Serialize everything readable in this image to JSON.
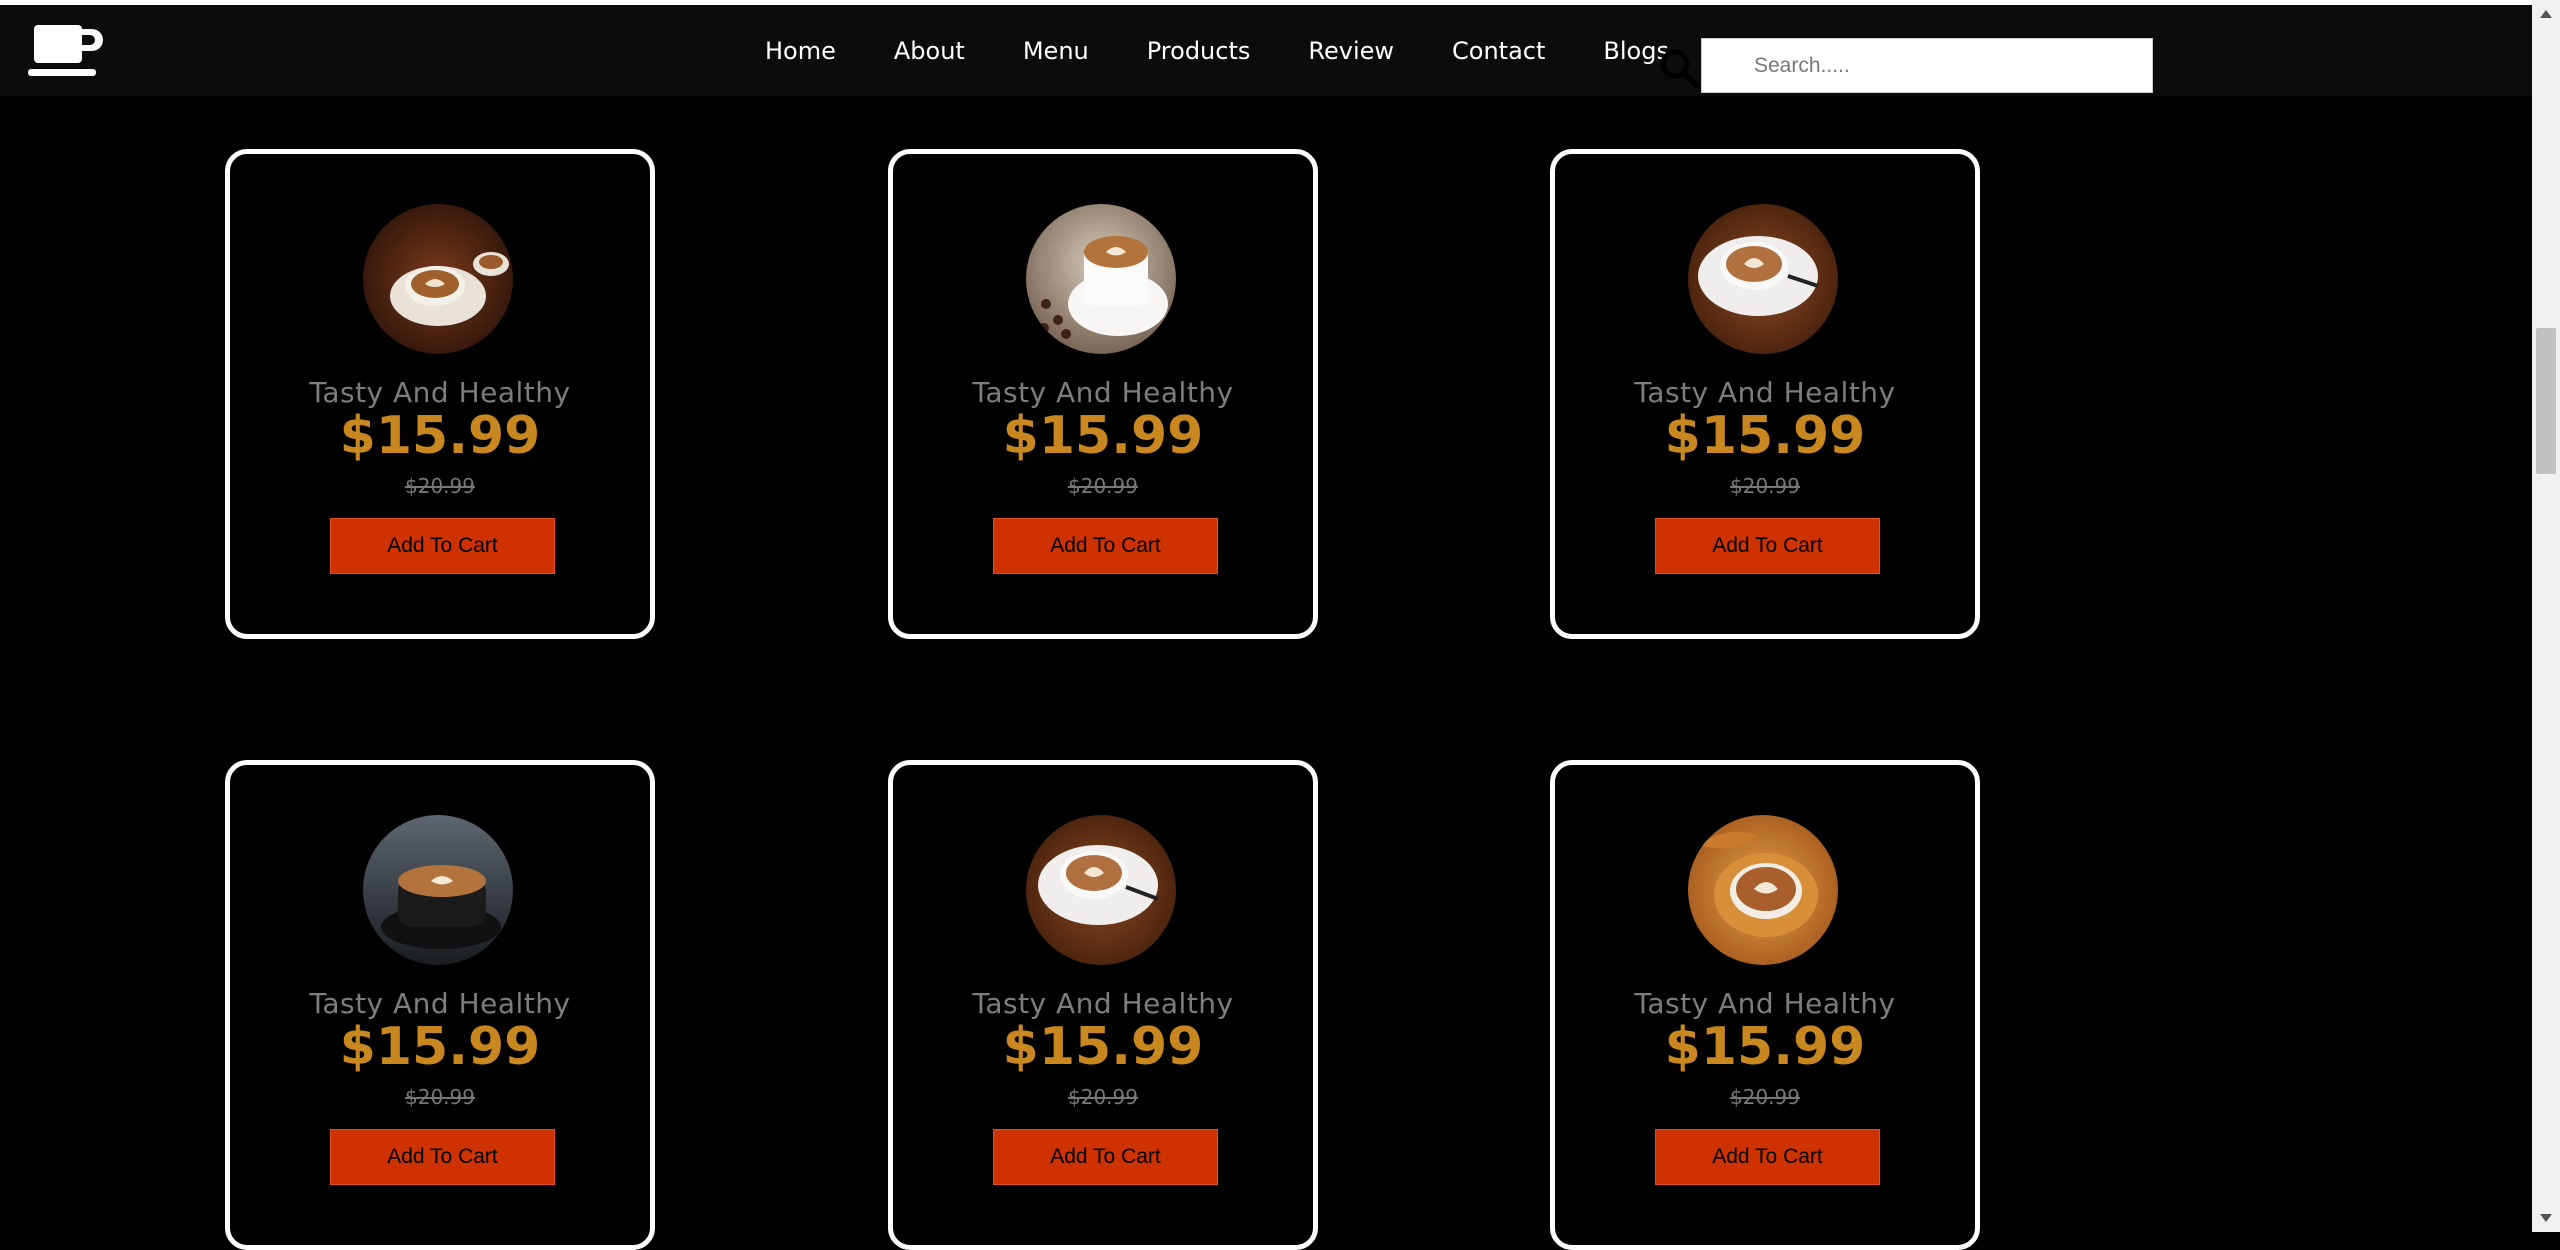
{
  "header": {
    "logo_icon": "coffee-cup-icon",
    "nav": [
      "Home",
      "About",
      "Menu",
      "Products",
      "Review",
      "Contact",
      "Blogs"
    ],
    "search_icon": "search-icon",
    "search_placeholder": "Search....."
  },
  "products": [
    {
      "title": "Tasty And Healthy",
      "price": "$15.99",
      "old_price": "$20.99",
      "button": "Add To Cart",
      "image": "coffee-latte-photo-1"
    },
    {
      "title": "Tasty And Healthy",
      "price": "$15.99",
      "old_price": "$20.99",
      "button": "Add To Cart",
      "image": "coffee-latte-photo-2"
    },
    {
      "title": "Tasty And Healthy",
      "price": "$15.99",
      "old_price": "$20.99",
      "button": "Add To Cart",
      "image": "coffee-latte-photo-3"
    },
    {
      "title": "Tasty And Healthy",
      "price": "$15.99",
      "old_price": "$20.99",
      "button": "Add To Cart",
      "image": "coffee-latte-photo-4"
    },
    {
      "title": "Tasty And Healthy",
      "price": "$15.99",
      "old_price": "$20.99",
      "button": "Add To Cart",
      "image": "coffee-latte-photo-5"
    },
    {
      "title": "Tasty And Healthy",
      "price": "$15.99",
      "old_price": "$20.99",
      "button": "Add To Cart",
      "image": "coffee-latte-photo-6"
    }
  ],
  "colors": {
    "background": "#000000",
    "navbar": "#0c0c0c",
    "price": "#c8871f",
    "button": "#cd3200",
    "title": "#7d7d7d"
  }
}
